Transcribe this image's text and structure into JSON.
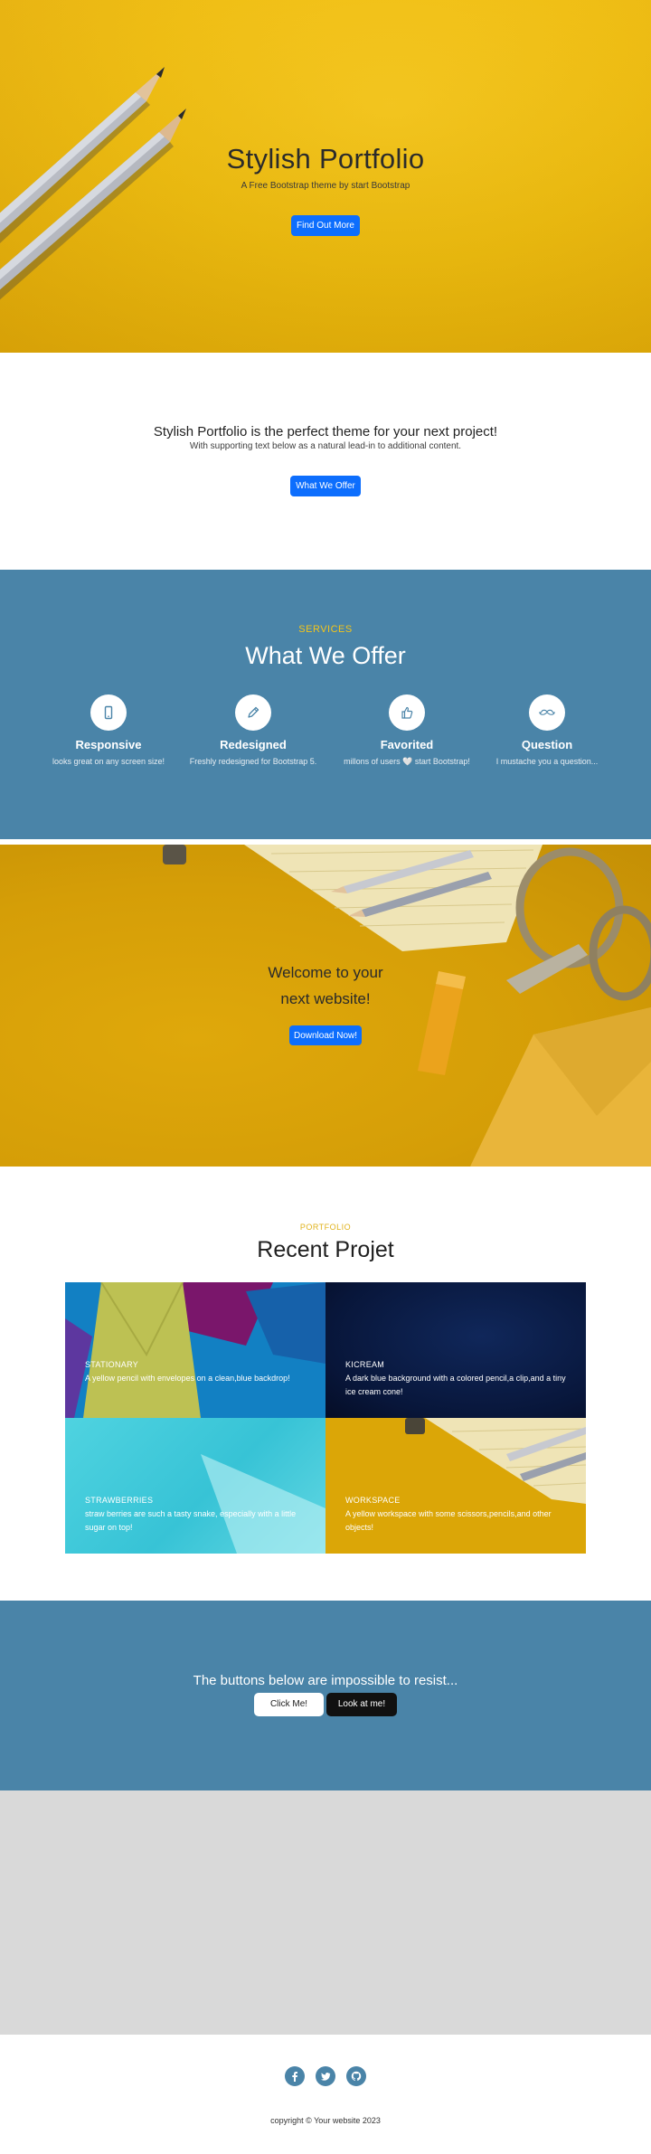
{
  "hero": {
    "title": "Stylish Portfolio",
    "subtitle": "A Free Bootstrap theme by start Bootstrap",
    "button_label": "Find Out More"
  },
  "about": {
    "title": "Stylish Portfolio is the perfect theme for your next project!",
    "subtitle": "With supporting text below as a natural lead-in to additional content.",
    "button_label": "What We Offer"
  },
  "services": {
    "kicker": "SERVICES",
    "title": "What We Offer",
    "items": [
      {
        "icon": "phone-icon",
        "name": "Responsive",
        "description": "looks great on any screen size!"
      },
      {
        "icon": "pencil-icon",
        "name": "Redesigned",
        "description": "Freshly redesigned for Bootstrap 5."
      },
      {
        "icon": "thumbs-up-icon",
        "name": "Favorited",
        "description": "millons of users 🤍 start Bootstrap!"
      },
      {
        "icon": "mustache-icon",
        "name": "Question",
        "description": "I mustache you a question..."
      }
    ]
  },
  "callout": {
    "line1": "Welcome to your",
    "line2": "next website!",
    "button_label": "Download Now!"
  },
  "portfolio": {
    "kicker": "PORTFOLIO",
    "title": "Recent Projet",
    "items": [
      {
        "name": "STATIONARY",
        "description": "A yellow pencil with envelopes on a clean,blue backdrop!"
      },
      {
        "name": "KICREAM",
        "description": "A dark blue background with a colored pencil,a clip,and a tiny ice cream cone!"
      },
      {
        "name": "STRAWBERRIES",
        "description": "straw berries are such a tasty snake, especially with a little sugar on top!"
      },
      {
        "name": "WORKSPACE",
        "description": "A yellow workspace with some scissors,pencils,and other objects!"
      }
    ]
  },
  "cta": {
    "title": "The buttons below are impossible to resist...",
    "button1_label": "Click Me!",
    "button2_label": "Look at me!"
  },
  "footer": {
    "social_icons": [
      "facebook-icon",
      "twitter-icon",
      "github-icon"
    ],
    "copyright": "copyright © Your website 2023"
  },
  "colors": {
    "accent_blue": "#0d6efd",
    "section_blue": "#4a84a8",
    "hero_yellow": "#efbc0c",
    "kicker_yellow": "#f5c518"
  }
}
